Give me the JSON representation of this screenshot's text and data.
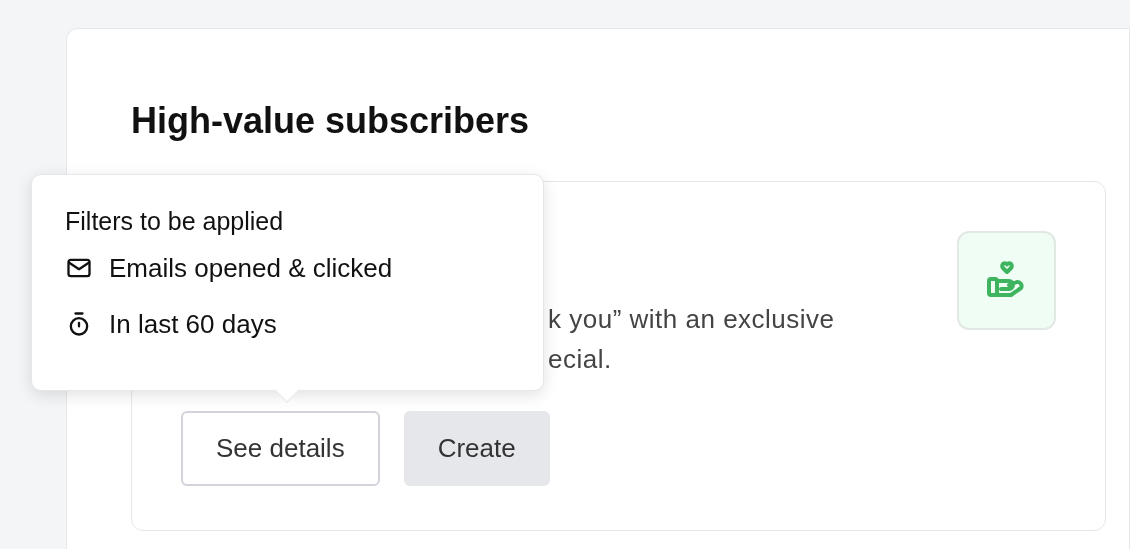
{
  "heading": "High-value subscribers",
  "card": {
    "description_lines": [
      "k you” with an exclusive",
      "ecial."
    ],
    "buttons": [
      {
        "label": "See details",
        "kind": "outline"
      },
      {
        "label": "Create",
        "kind": "filled"
      }
    ]
  },
  "tooltip": {
    "title": "Filters to be applied",
    "items": [
      {
        "kind": "mail",
        "label": "Emails opened & clicked"
      },
      {
        "kind": "timer",
        "label": "In last 60 days"
      }
    ]
  }
}
